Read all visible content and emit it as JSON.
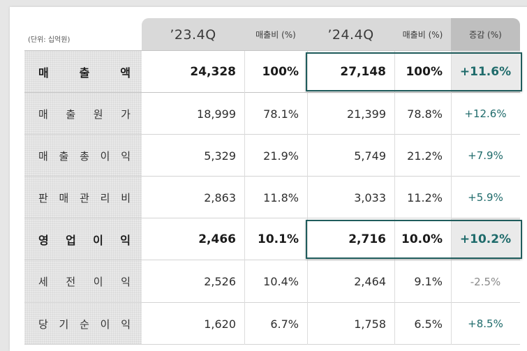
{
  "unit_label": "(단위: 십억원)",
  "columns": [
    {
      "label": "’23.4Q",
      "kind": "period"
    },
    {
      "label": "매출비 (%)",
      "kind": "ratio"
    },
    {
      "label": "’24.4Q",
      "kind": "period"
    },
    {
      "label": "매출비 (%)",
      "kind": "ratio"
    },
    {
      "label": "증감 (%)",
      "kind": "change"
    }
  ],
  "rows": [
    {
      "label": "매출액",
      "chars": [
        "매",
        "출",
        "액"
      ],
      "v2023": "24,328",
      "r2023": "100%",
      "v2024": "27,148",
      "r2024": "100%",
      "change": "+11.6%",
      "highlight": true
    },
    {
      "label": "매출원가",
      "chars": [
        "매",
        "출",
        "원",
        "가"
      ],
      "v2023": "18,999",
      "r2023": "78.1%",
      "v2024": "21,399",
      "r2024": "78.8%",
      "change": "+12.6%",
      "highlight": false
    },
    {
      "label": "매출총이익",
      "chars": [
        "매",
        "출",
        "총",
        "이",
        "익"
      ],
      "v2023": "5,329",
      "r2023": "21.9%",
      "v2024": "5,749",
      "r2024": "21.2%",
      "change": "+7.9%",
      "highlight": false
    },
    {
      "label": "판매관리비",
      "chars": [
        "판",
        "매",
        "관",
        "리",
        "비"
      ],
      "v2023": "2,863",
      "r2023": "11.8%",
      "v2024": "3,033",
      "r2024": "11.2%",
      "change": "+5.9%",
      "highlight": false
    },
    {
      "label": "영업이익",
      "chars": [
        "영",
        "업",
        "이",
        "익"
      ],
      "v2023": "2,466",
      "r2023": "10.1%",
      "v2024": "2,716",
      "r2024": "10.0%",
      "change": "+10.2%",
      "highlight": true
    },
    {
      "label": "세전이익",
      "chars": [
        "세",
        "전",
        "이",
        "익"
      ],
      "v2023": "2,526",
      "r2023": "10.4%",
      "v2024": "2,464",
      "r2024": "9.1%",
      "change": "-2.5%",
      "highlight": false
    },
    {
      "label": "당기순이익",
      "chars": [
        "당",
        "기",
        "순",
        "이",
        "익"
      ],
      "v2023": "1,620",
      "r2023": "6.7%",
      "v2024": "1,758",
      "r2024": "6.5%",
      "change": "+8.5%",
      "highlight": false
    }
  ],
  "colors": {
    "positive_change": "#1f6b6b",
    "negative_change": "#8a8a8a",
    "highlight_border": "#1f5c5c"
  }
}
